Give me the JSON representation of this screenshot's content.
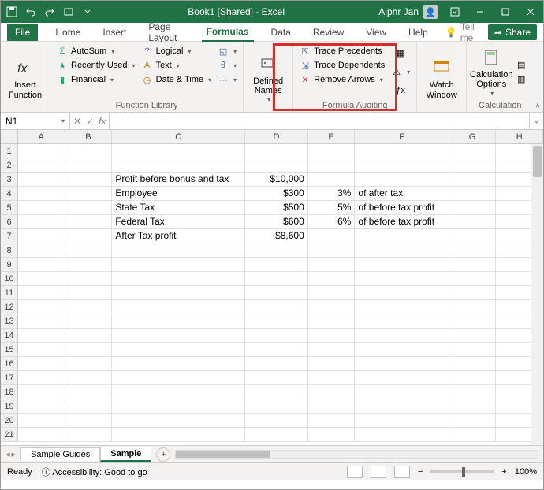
{
  "titlebar": {
    "title": "Book1 [Shared] - Excel",
    "user": "Alphr Jan"
  },
  "tabs": {
    "file": "File",
    "home": "Home",
    "insert": "Insert",
    "pagelayout": "Page Layout",
    "formulas": "Formulas",
    "data": "Data",
    "review": "Review",
    "view": "View",
    "help": "Help",
    "tellme": "Tell me",
    "share": "Share"
  },
  "ribbon": {
    "insertfn": "Insert Function",
    "autosum": "AutoSum",
    "recent": "Recently Used",
    "financial": "Financial",
    "logical": "Logical",
    "text": "Text",
    "datetime": "Date & Time",
    "lib_label": "Function Library",
    "defnames": "Defined Names",
    "trace_prec": "Trace Precedents",
    "trace_dep": "Trace Dependents",
    "remove_arrows": "Remove Arrows",
    "audit_label": "Formula Auditing",
    "watch": "Watch Window",
    "calcopts": "Calculation Options",
    "calc_label": "Calculation"
  },
  "namebox": "N1",
  "cols": {
    "A": 60,
    "B": 60,
    "C": 170,
    "D": 80,
    "E": 60,
    "F": 120,
    "G": 60,
    "H": 60
  },
  "rows": 21,
  "data": {
    "3": {
      "C": "Profit before bonus and tax",
      "D": "$10,000"
    },
    "4": {
      "C": "Employee",
      "D": "$300",
      "E": "3%",
      "F": "of after tax"
    },
    "5": {
      "C": "State Tax",
      "D": "$500",
      "E": "5%",
      "F": "of before tax profit"
    },
    "6": {
      "C": "Federal Tax",
      "D": "$600",
      "E": "6%",
      "F": "of before tax profit"
    },
    "7": {
      "C": "After Tax profit",
      "D": "$8,600"
    }
  },
  "sheets": {
    "s1": "Sample Guides",
    "s2": "Sample"
  },
  "status": {
    "ready": "Ready",
    "access": "Accessibility: Good to go",
    "zoom": "100%"
  }
}
